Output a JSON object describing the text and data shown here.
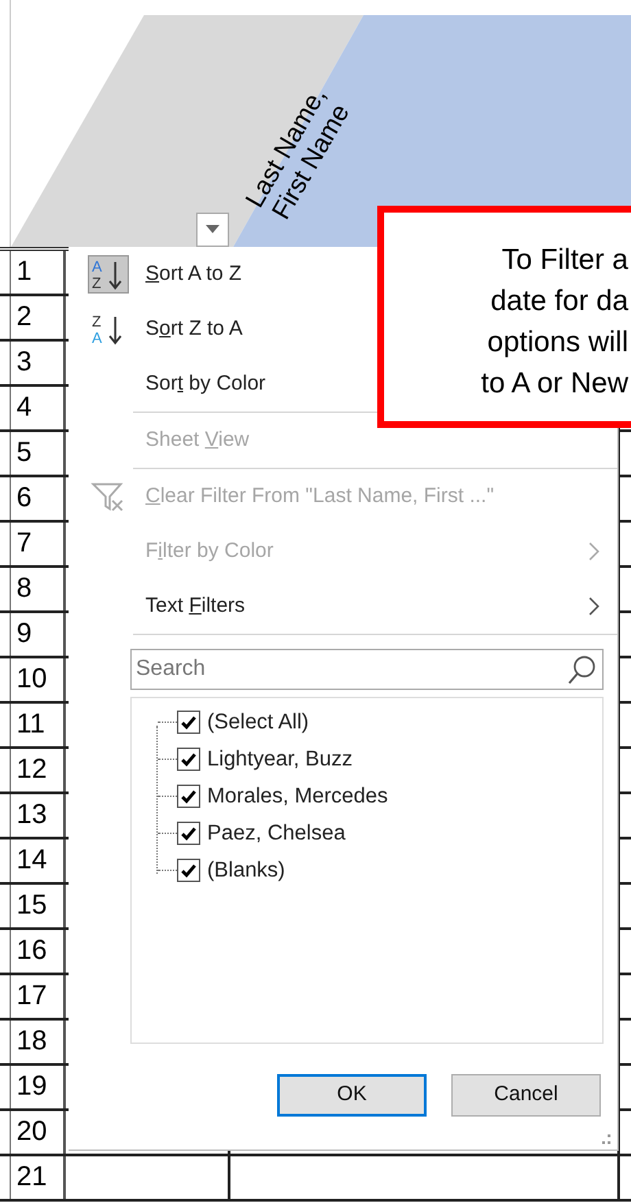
{
  "column_header": {
    "label": "Last Name, First Name"
  },
  "row_numbers": [
    "1",
    "2",
    "3",
    "4",
    "5",
    "6",
    "7",
    "8",
    "9",
    "10",
    "11",
    "12",
    "13",
    "14",
    "15",
    "16",
    "17",
    "18",
    "19",
    "20",
    "21"
  ],
  "filter_menu": {
    "items": [
      {
        "kind": "sort-ascending",
        "icon_letters": [
          "A",
          "Z"
        ],
        "label": {
          "key": "S",
          "after": "ort A to Z"
        },
        "highlighted": true,
        "disabled": false,
        "submenu": false
      },
      {
        "kind": "sort-descending",
        "icon_letters": [
          "Z",
          "A"
        ],
        "label": {
          "before": "S",
          "key": "o",
          "after": "rt Z to A"
        },
        "highlighted": false,
        "disabled": false,
        "submenu": false
      },
      {
        "kind": "command",
        "label": {
          "before": "Sor",
          "key": "t",
          "after": " by Color"
        },
        "highlighted": false,
        "disabled": false,
        "submenu": false
      },
      {
        "kind": "separator"
      },
      {
        "kind": "command",
        "label": {
          "before": "Sheet ",
          "key": "V",
          "after": "iew"
        },
        "highlighted": false,
        "disabled": true,
        "submenu": false
      },
      {
        "kind": "separator"
      },
      {
        "kind": "clear-filter",
        "label": {
          "key": "C",
          "after": "lear Filter From \"Last Name, First ...\""
        },
        "highlighted": false,
        "disabled": true,
        "submenu": false
      },
      {
        "kind": "command",
        "label": {
          "before": "F",
          "key": "i",
          "after": "lter by Color"
        },
        "highlighted": false,
        "disabled": true,
        "submenu": true
      },
      {
        "kind": "command",
        "label": {
          "before": "Text ",
          "key": "F",
          "after": "ilters"
        },
        "highlighted": false,
        "disabled": false,
        "submenu": true
      },
      {
        "kind": "separator"
      }
    ],
    "search": {
      "placeholder": "Search"
    },
    "values": [
      {
        "label": "(Select All)",
        "checked": true
      },
      {
        "label": "Lightyear, Buzz",
        "checked": true
      },
      {
        "label": "Morales, Mercedes",
        "checked": true
      },
      {
        "label": "Paez, Chelsea",
        "checked": true
      },
      {
        "label": "(Blanks)",
        "checked": true
      }
    ],
    "buttons": [
      {
        "label": "OK",
        "default": true
      },
      {
        "label": "Cancel",
        "default": false
      }
    ]
  },
  "callout": {
    "lines": [
      "To Filter a",
      "date for da",
      "options will",
      "to A or New"
    ]
  }
}
